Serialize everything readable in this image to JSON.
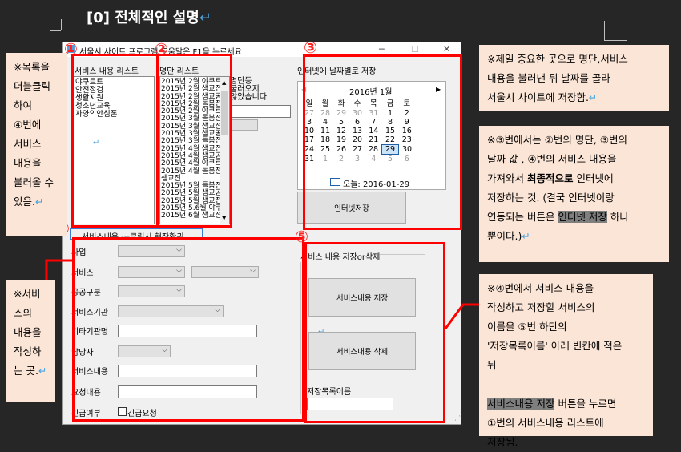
{
  "heading": {
    "text": "[0] 전체적인 설명",
    "mark": "↵"
  },
  "window": {
    "title": "서울시 사이트 프로그램 도움말은 F1을 누르세요",
    "minimize": "─",
    "maximize": "☐",
    "close": "✕",
    "service_list": {
      "label": "서비스 내용 리스트",
      "items": [
        "야쿠르트",
        "안전점검",
        "생활지원",
        "청소년교육",
        "자양의안심폰"
      ],
      "mark": "↵"
    },
    "group_list": {
      "label": "명단 리스트",
      "items": [
        "2015년 2월 야쿠르트",
        "2015년 2월 생교전",
        "2015년 2월 생교공",
        "2015년 2월 돌봄전체",
        "2015년 2월 야쿠르트",
        "2015년 3월 돌봄전체",
        "2015년 3월 생교전",
        "2015년 3월 생교공",
        "2015년 3월 돌봄전체",
        "2015년 4월 생교전",
        "2015년 4월 생교공",
        "2015년 4월 야쿠르트",
        "2015년 4월 돌봄전체",
        "생교전",
        "2015년 5월 돌봄전",
        "2015년 5월 생교공",
        "2015년 5월 생교전",
        "2015년 5.6월 야쿠",
        "2015년 6월 생교전"
      ],
      "side_text": [
        "명단등",
        "불러오지",
        "않았습니다"
      ]
    },
    "internet_save": {
      "label": "인터넷에 날짜별로 저장",
      "calendar": {
        "month": "2016년 1월",
        "weekdays": [
          "일",
          "월",
          "화",
          "수",
          "목",
          "금",
          "토"
        ],
        "weeks": [
          [
            "27",
            "28",
            "29",
            "30",
            "31",
            "1",
            "2"
          ],
          [
            "3",
            "4",
            "5",
            "6",
            "7",
            "8",
            "9"
          ],
          [
            "10",
            "11",
            "12",
            "13",
            "14",
            "15",
            "16"
          ],
          [
            "17",
            "18",
            "19",
            "20",
            "21",
            "22",
            "23"
          ],
          [
            "24",
            "25",
            "26",
            "27",
            "28",
            "29",
            "30"
          ],
          [
            "31",
            "1",
            "2",
            "3",
            "4",
            "5",
            "6"
          ]
        ],
        "selected": "29",
        "today": "오늘: 2016-01-29"
      },
      "button": "인터넷저장"
    },
    "service_form": {
      "label": "서비스내용 ---클릭시 현장확귀",
      "fields": [
        "사업",
        "서비스",
        "공공구분",
        "서비스기관",
        "기타기관명",
        "담당자",
        "서비스내용",
        "요청내용",
        "긴급여부"
      ],
      "checkbox_label": "긴급요청"
    },
    "save_delete": {
      "label": "서비스 내용 저장or삭제",
      "save_button": "서비스내용 저장",
      "delete_button": "서비스내용 삭제",
      "save_list_label": "저장목록이름"
    },
    "markers": {
      "one": "①",
      "two": "②",
      "three": "③",
      "four": "④",
      "five": "⑤"
    }
  },
  "notes": {
    "left_top": {
      "lines": [
        "※목록을",
        "더블클릭",
        "하여",
        "④번에",
        "서비스",
        "내용을",
        "불러올 수",
        "있음."
      ]
    },
    "left_bottom": {
      "lines": [
        "※서비",
        "스의",
        "내용을",
        "작성하",
        "는 곳."
      ]
    },
    "right_1": {
      "lines": [
        "※제일 중요한 곳으로 명단,서비스",
        "내용을 불러낸 뒤 날짜를 골라",
        "서울시 사이트에 저장함."
      ]
    },
    "right_2": {
      "lines": [
        "※③번에서는 ②번의 명단, ③번의",
        "날짜 값 , ④번의 서비스 내용을",
        "가져와서 ",
        "최종적으로",
        " 인터넷에",
        "저장하는 것. (결국 인터넷이랑",
        "연동되는 버튼은 ",
        "인터넷 저장",
        " 하나",
        "뿐이다.)"
      ]
    },
    "right_3": {
      "lines": [
        "※④번에서 서비스 내용을",
        "작성하고 저장할 서비스의",
        "이름을 ⑤번 하단의",
        "'저장목록이름' 아래 빈칸에 적은",
        "뒤",
        "서비스내용 저장",
        " 버튼을 누르면",
        "①번의 서비스내용 리스트에",
        "저장됨."
      ]
    }
  },
  "colors": {
    "highlight_red": "#ff0000",
    "note_bg": "#fbe5d6",
    "page_bg": "#262626"
  }
}
